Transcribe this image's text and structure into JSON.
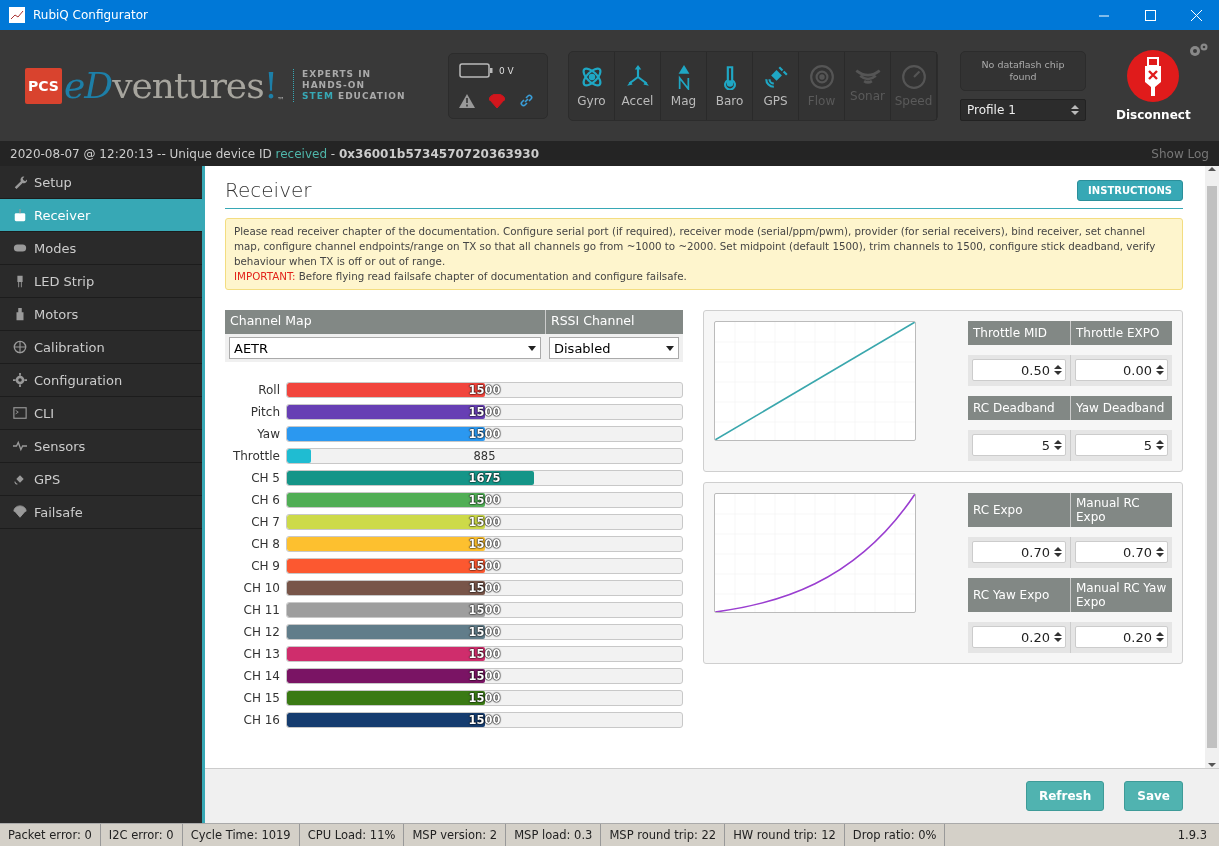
{
  "window": {
    "title": "RubiQ Configurator"
  },
  "logo": {
    "badge": "PCS",
    "brand_a": "eD",
    "brand_b": "ventures",
    "brand_mark": "!",
    "trademark": "™",
    "tagline": [
      "EXPERTS IN",
      "HANDS-ON",
      "**STEM** EDUCATION"
    ]
  },
  "battery": {
    "reading": "0 V"
  },
  "sensors": [
    {
      "label": "Gyro",
      "kind": "gyro",
      "active": true
    },
    {
      "label": "Accel",
      "kind": "accel",
      "active": true
    },
    {
      "label": "Mag",
      "kind": "mag",
      "active": true
    },
    {
      "label": "Baro",
      "kind": "baro",
      "active": true
    },
    {
      "label": "GPS",
      "kind": "gps",
      "active": true
    },
    {
      "label": "Flow",
      "kind": "flow",
      "active": false
    },
    {
      "label": "Sonar",
      "kind": "sonar",
      "active": false
    },
    {
      "label": "Speed",
      "kind": "speed",
      "active": false
    }
  ],
  "dataflash": {
    "status": "No dataflash chip found"
  },
  "profile": {
    "value": "Profile 1"
  },
  "connect_button": {
    "label": "Disconnect"
  },
  "device_line": "2020-08-07 @ 12:20:13 -- Unique device ID *received* - **0x36001b5734570720363930**",
  "show_log": "Show Log",
  "sidebar": {
    "items": [
      {
        "label": "Setup",
        "kind": "wrench",
        "selected": false
      },
      {
        "label": "Receiver",
        "kind": "receiver",
        "selected": true
      },
      {
        "label": "Modes",
        "kind": "modes",
        "selected": false
      },
      {
        "label": "LED Strip",
        "kind": "led",
        "selected": false
      },
      {
        "label": "Motors",
        "kind": "motor",
        "selected": false
      },
      {
        "label": "Calibration",
        "kind": "calib",
        "selected": false
      },
      {
        "label": "Configuration",
        "kind": "gear",
        "selected": false
      },
      {
        "label": "CLI",
        "kind": "cli",
        "selected": false
      },
      {
        "label": "Sensors",
        "kind": "pulse",
        "selected": false
      },
      {
        "label": "GPS",
        "kind": "gps",
        "selected": false
      },
      {
        "label": "Failsafe",
        "kind": "parachute",
        "selected": false
      }
    ]
  },
  "page": {
    "title": "Receiver",
    "instructions_button": "INSTRUCTIONS",
    "notice": "Please read receiver chapter of the documentation. Configure serial port (if required), receiver mode (serial/ppm/pwm), provider (for serial receivers), bind receiver, set channel map, configure channel endpoints/range on TX so that all channels go from ~1000 to ~2000. Set midpoint (default 1500), trim channels to 1500, configure stick deadband, verify behaviour when TX is off or out of range.",
    "notice_warning": "*IMPORTANT:* Before flying read failsafe chapter of documentation and configure failsafe."
  },
  "channel_map": {
    "label": "Channel Map",
    "value": "AETR"
  },
  "rssi_channel": {
    "label": "RSSI Channel",
    "value": "Disabled"
  },
  "channels": [
    {
      "name": "Roll",
      "value": "1500",
      "level": 0.5,
      "color": "#f1453d"
    },
    {
      "name": "Pitch",
      "value": "1500",
      "level": 0.5,
      "color": "#673fb4"
    },
    {
      "name": "Yaw",
      "value": "1500",
      "level": 0.5,
      "color": "#2b98f0"
    },
    {
      "name": "Throttle",
      "value": "885",
      "level": 0.06,
      "color": "#1fbcd2"
    },
    {
      "name": "CH 5",
      "value": "1675",
      "level": 0.625,
      "color": "#159588"
    },
    {
      "name": "CH 6",
      "value": "1500",
      "level": 0.5,
      "color": "#50ae55"
    },
    {
      "name": "CH 7",
      "value": "1500",
      "level": 0.5,
      "color": "#cdda49"
    },
    {
      "name": "CH 8",
      "value": "1500",
      "level": 0.5,
      "color": "#fdc02f"
    },
    {
      "name": "CH 9",
      "value": "1500",
      "level": 0.5,
      "color": "#fc5830"
    },
    {
      "name": "CH 10",
      "value": "1500",
      "level": 0.5,
      "color": "#785549"
    },
    {
      "name": "CH 11",
      "value": "1500",
      "level": 0.5,
      "color": "#9e9e9e"
    },
    {
      "name": "CH 12",
      "value": "1500",
      "level": 0.5,
      "color": "#617d8a"
    },
    {
      "name": "CH 13",
      "value": "1500",
      "level": 0.5,
      "color": "#cf2d6c"
    },
    {
      "name": "CH 14",
      "value": "1500",
      "level": 0.5,
      "color": "#7a1464"
    },
    {
      "name": "CH 15",
      "value": "1500",
      "level": 0.5,
      "color": "#3a7a14"
    },
    {
      "name": "CH 16",
      "value": "1500",
      "level": 0.5,
      "color": "#153c6f"
    }
  ],
  "curve_panels": [
    {
      "kind": "linear",
      "fields": [
        {
          "label": "Throttle MID",
          "value": "0.50"
        },
        {
          "label": "Throttle EXPO",
          "value": "0.00"
        },
        {
          "label": "RC Deadband",
          "value": "5"
        },
        {
          "label": "Yaw Deadband",
          "value": "5"
        }
      ]
    },
    {
      "kind": "expo",
      "fields": [
        {
          "label": "RC Expo",
          "value": "0.70"
        },
        {
          "label": "Manual RC Expo",
          "value": "0.70"
        },
        {
          "label": "RC Yaw Expo",
          "value": "0.20"
        },
        {
          "label": "Manual RC Yaw Expo",
          "value": "0.20"
        }
      ]
    }
  ],
  "footer_buttons": [
    "Refresh",
    "Save"
  ],
  "status_bar": {
    "items": [
      "Packet error: 0",
      "I2C error: 0",
      "Cycle Time: 1019",
      "CPU Load: 11%",
      "MSP version: 2",
      "MSP load: 0.3",
      "MSP round trip: 22",
      "HW round trip: 12",
      "Drop ratio: 0%"
    ],
    "version": "1.9.3"
  }
}
